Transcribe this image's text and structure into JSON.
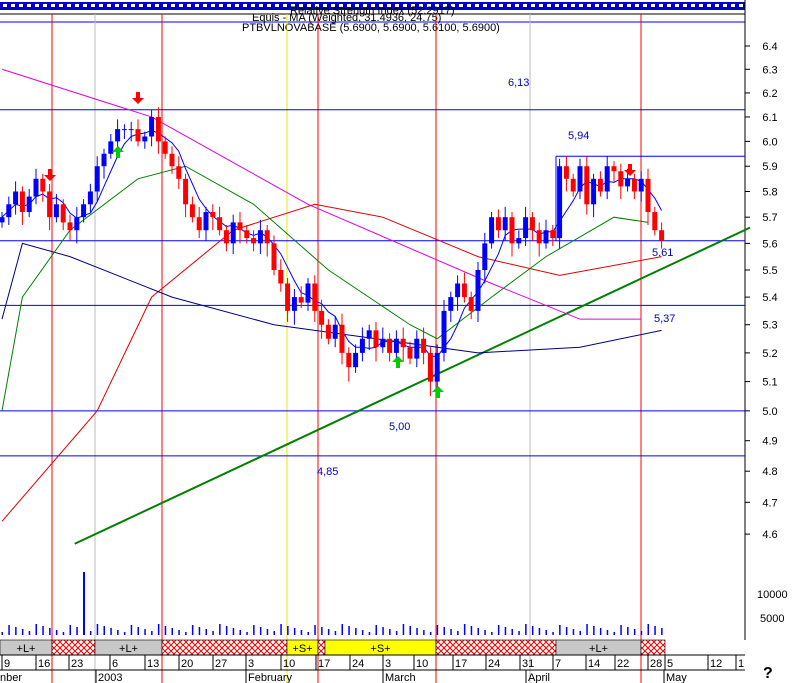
{
  "header": {
    "line1": "Relative Strength Index (52.2917)",
    "line2": "Equis - MA (Weighted, 31.4936, 24.75)",
    "line3": "PTBVLNOVABASE (5.6900, 5.6900, 5.6100, 5.6900)"
  },
  "chart_data": {
    "type": "candlestick",
    "scale": "log",
    "ylim": [
      4.55,
      6.5
    ],
    "yticks": [
      "6.4",
      "6.3",
      "6.2",
      "6.1",
      "6.0",
      "5.9",
      "5.8",
      "5.7",
      "5.6",
      "5.5",
      "5.4",
      "5.3",
      "5.2",
      "5.1",
      "5.0",
      "4.9",
      "4.8",
      "4.7",
      "4.6"
    ],
    "volume_ticks": [
      "10000",
      "5000"
    ],
    "closes": [
      5.7,
      5.75,
      5.8,
      5.72,
      5.78,
      5.85,
      5.8,
      5.7,
      5.75,
      5.68,
      5.65,
      5.7,
      5.75,
      5.8,
      5.9,
      5.95,
      6.0,
      6.05,
      6.05,
      6.05,
      6.0,
      6.02,
      6.1,
      6.0,
      5.95,
      5.9,
      5.85,
      5.75,
      5.7,
      5.65,
      5.72,
      5.7,
      5.65,
      5.6,
      5.68,
      5.65,
      5.62,
      5.6,
      5.65,
      5.6,
      5.5,
      5.45,
      5.35,
      5.4,
      5.38,
      5.45,
      5.35,
      5.3,
      5.25,
      5.3,
      5.2,
      5.15,
      5.2,
      5.25,
      5.28,
      5.22,
      5.25,
      5.2,
      5.25,
      5.22,
      5.18,
      5.25,
      5.2,
      5.1,
      5.2,
      5.35,
      5.4,
      5.45,
      5.4,
      5.35,
      5.5,
      5.6,
      5.7,
      5.65,
      5.7,
      5.6,
      5.62,
      5.7,
      5.65,
      5.6,
      5.65,
      5.62,
      5.9,
      5.85,
      5.8,
      5.9,
      5.75,
      5.85,
      5.8,
      5.9,
      5.88,
      5.82,
      5.85,
      5.8,
      5.85,
      5.72,
      5.65,
      5.61
    ],
    "moving_averages": [
      {
        "name": "magenta",
        "color": "#e000e0",
        "points": [
          [
            0,
            6.3
          ],
          [
            22,
            6.1
          ],
          [
            45,
            5.75
          ],
          [
            72,
            5.45
          ],
          [
            85,
            5.32
          ],
          [
            94,
            5.32
          ]
        ]
      },
      {
        "name": "red",
        "color": "#e00000",
        "points": [
          [
            0,
            4.64
          ],
          [
            14,
            5.0
          ],
          [
            22,
            5.4
          ],
          [
            34,
            5.65
          ],
          [
            46,
            5.75
          ],
          [
            56,
            5.7
          ],
          [
            70,
            5.55
          ],
          [
            82,
            5.48
          ],
          [
            97,
            5.55
          ]
        ]
      },
      {
        "name": "navy",
        "color": "#000080",
        "points": [
          [
            0,
            5.32
          ],
          [
            3,
            5.6
          ],
          [
            10,
            5.55
          ],
          [
            25,
            5.4
          ],
          [
            40,
            5.3
          ],
          [
            55,
            5.25
          ],
          [
            70,
            5.2
          ],
          [
            85,
            5.22
          ],
          [
            97,
            5.28
          ]
        ]
      },
      {
        "name": "green",
        "color": "#008000",
        "points": [
          [
            0,
            5.0
          ],
          [
            3,
            5.4
          ],
          [
            10,
            5.65
          ],
          [
            20,
            5.85
          ],
          [
            27,
            5.9
          ],
          [
            37,
            5.75
          ],
          [
            48,
            5.5
          ],
          [
            60,
            5.3
          ],
          [
            64,
            5.25
          ],
          [
            72,
            5.4
          ],
          [
            80,
            5.55
          ],
          [
            90,
            5.7
          ],
          [
            95,
            5.68
          ]
        ]
      }
    ],
    "levels": [
      {
        "value": 6.13,
        "label": "6,13"
      },
      {
        "value": 5.94,
        "label": "5,94"
      },
      {
        "value": 5.61,
        "label": "5,61"
      },
      {
        "value": 5.37,
        "label": "5,37"
      },
      {
        "value": 5.0,
        "label": "5,00"
      },
      {
        "value": 4.85,
        "label": "4,85"
      }
    ],
    "trendline": [
      [
        10.7,
        4.57
      ],
      [
        110,
        5.66
      ]
    ],
    "signals": [
      "+L+",
      "+L+",
      "+S+",
      "+S+",
      "+L+"
    ],
    "day_labels": [
      "9",
      "16",
      "23",
      "6",
      "13",
      "20",
      "27",
      "3",
      "10",
      "17",
      "24",
      "3",
      "10",
      "17",
      "24",
      "31",
      "7",
      "14",
      "22",
      "28",
      "5",
      "12",
      "1"
    ],
    "month_labels": [
      "nber",
      "2003",
      "February",
      "March",
      "April",
      "May"
    ],
    "help": "?"
  }
}
